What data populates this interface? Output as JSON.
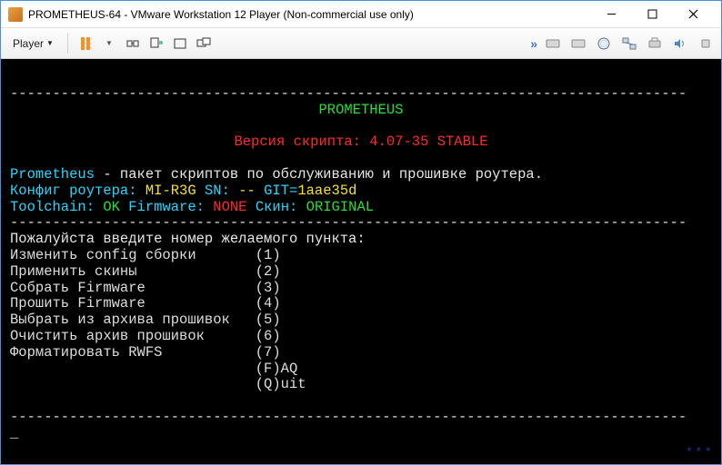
{
  "window": {
    "title": "PROMETHEUS-64 - VMware Workstation 12 Player (Non-commercial use only)"
  },
  "toolbar": {
    "player_label": "Player"
  },
  "dash_line": "--------------------------------------------------------------------------------",
  "header": {
    "name": "PROMETHEUS",
    "version_label": "Версия скрипта:",
    "version_value": "4.07-35 STABLE",
    "desc_prefix": "Prometheus",
    "desc_rest": " - пакет скриптов по обслуживанию и прошивке роутера.",
    "config_label": "Конфиг роутера:",
    "config_model": "MI-R3G",
    "sn_label": "SN:",
    "sn_value": "--",
    "git_label": "GIT=",
    "git_value": "1aae35d",
    "toolchain_label": "Toolchain:",
    "toolchain_status": "OK",
    "firmware_label": "Firmware:",
    "firmware_status": "NONE",
    "skin_label": "Скин:",
    "skin_value": "ORIGINAL"
  },
  "menu": {
    "prompt": "Пожалуйста введите номер желаемого пункта:",
    "items": [
      {
        "label": "Изменить config сборки",
        "key": "(1)"
      },
      {
        "label": "Применить скины",
        "key": "(2)"
      },
      {
        "label": "Собрать Firmware",
        "key": "(3)"
      },
      {
        "label": "Прошить Firmware",
        "key": "(4)"
      },
      {
        "label": "Выбрать из архива прошивок",
        "key": "(5)"
      },
      {
        "label": "Очистить архив прошивок",
        "key": "(6)"
      },
      {
        "label": "Форматировать RWFS",
        "key": "(7)"
      }
    ],
    "extra": [
      {
        "label": "",
        "key": "(F)AQ"
      },
      {
        "label": "",
        "key": "(Q)uit"
      }
    ]
  },
  "watermark": "***"
}
